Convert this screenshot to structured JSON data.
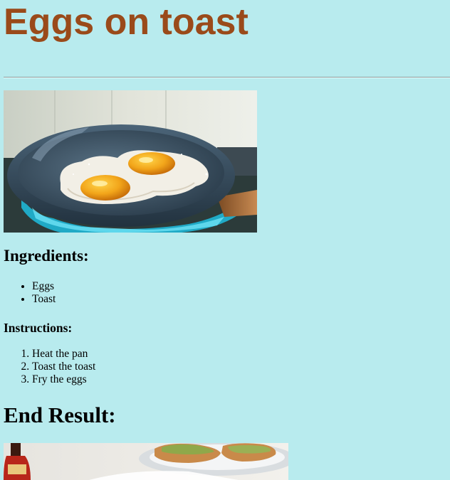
{
  "title": "Eggs on toast",
  "hero_image": {
    "alt": "Fried eggs in a pan"
  },
  "ingredients": {
    "heading": "Ingredients:",
    "items": [
      "Eggs",
      "Toast"
    ]
  },
  "instructions": {
    "heading": "Instructions:",
    "steps": [
      "Heat the pan",
      "Toast the toast",
      "Fry the eggs"
    ]
  },
  "end_result": {
    "heading": "End Result:",
    "image_alt": "Eggs on toast plated"
  },
  "colors": {
    "background": "#b8ebee",
    "title": "#9a4a1a"
  }
}
